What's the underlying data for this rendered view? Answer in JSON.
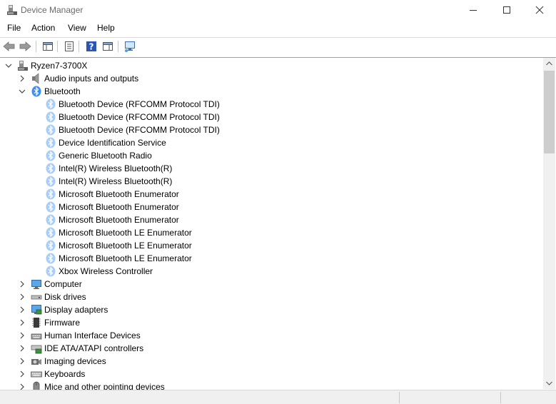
{
  "window": {
    "title": "Device Manager",
    "controls": [
      "minimize",
      "maximize",
      "close"
    ]
  },
  "menu": [
    "File",
    "Action",
    "View",
    "Help"
  ],
  "toolbar": [
    "back-icon",
    "forward-icon",
    "show-hide-console-tree-icon",
    "properties-icon",
    "help-icon",
    "show-action-pane-icon",
    "scan-hardware-icon"
  ],
  "colors": {
    "bluetooth": "#3d8ef7",
    "bluetooth_light": "#a9cdf9",
    "scroll_thumb": "#cdcdcd"
  },
  "tree": {
    "root": "Ryzen7-3700X",
    "categories": [
      {
        "label": "Audio inputs and outputs",
        "icon": "speaker-icon",
        "expanded": false
      },
      {
        "label": "Bluetooth",
        "icon": "bluetooth-icon",
        "expanded": true,
        "children": [
          "Bluetooth Device (RFCOMM Protocol TDI)",
          "Bluetooth Device (RFCOMM Protocol TDI)",
          "Bluetooth Device (RFCOMM Protocol TDI)",
          "Device Identification Service",
          "Generic Bluetooth Radio",
          "Intel(R) Wireless Bluetooth(R)",
          "Intel(R) Wireless Bluetooth(R)",
          "Microsoft Bluetooth Enumerator",
          "Microsoft Bluetooth Enumerator",
          "Microsoft Bluetooth Enumerator",
          "Microsoft Bluetooth LE Enumerator",
          "Microsoft Bluetooth LE Enumerator",
          "Microsoft Bluetooth LE Enumerator",
          "Xbox Wireless Controller"
        ]
      },
      {
        "label": "Computer",
        "icon": "monitor-icon",
        "expanded": false
      },
      {
        "label": "Disk drives",
        "icon": "disk-drive-icon",
        "expanded": false
      },
      {
        "label": "Display adapters",
        "icon": "display-adapter-icon",
        "expanded": false
      },
      {
        "label": "Firmware",
        "icon": "firmware-chip-icon",
        "expanded": false
      },
      {
        "label": "Human Interface Devices",
        "icon": "hid-icon",
        "expanded": false
      },
      {
        "label": "IDE ATA/ATAPI controllers",
        "icon": "ide-controller-icon",
        "expanded": false
      },
      {
        "label": "Imaging devices",
        "icon": "camera-icon",
        "expanded": false
      },
      {
        "label": "Keyboards",
        "icon": "keyboard-icon",
        "expanded": false
      },
      {
        "label": "Mice and other pointing devices",
        "icon": "mouse-icon",
        "expanded": false
      }
    ]
  }
}
